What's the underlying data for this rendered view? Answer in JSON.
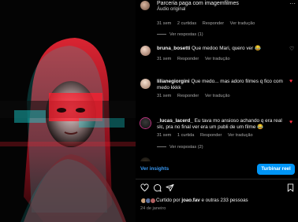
{
  "post": {
    "title": "Parceria paga com imagemfilmes",
    "subtitle": "Áudio original",
    "more_icon": "more-dots-icon"
  },
  "labels": {
    "reply": "Responder",
    "see_translation": "Ver tradução"
  },
  "comments": [
    {
      "meta_time": "31 sem",
      "meta_likes": "2 curtidas",
      "replies": "Ver respostas (1)",
      "text": ""
    },
    {
      "username": "bruna_bosetti",
      "text": "Que medoo Mari, quero ver 😂",
      "meta_time": "31 sem",
      "meta_likes": "",
      "replies": "",
      "liked": false
    },
    {
      "username": "lilianegiorgini",
      "text": "Que medo... mas adoro filmes q fico com medo kkkk",
      "meta_time": "31 sem",
      "meta_likes": "",
      "replies": "",
      "liked": true
    },
    {
      "username": "_lucas_lacerd_",
      "text": "Eu tava mo ansioso achando q era real slc, pra no final ver era um publi de um filme 😂",
      "meta_time": "31 sem",
      "meta_likes": "1 curtida",
      "replies": "Ver respostas (2)",
      "liked": true
    }
  ],
  "footer": {
    "insights": "Ver insights",
    "boost": "Turbinar reel",
    "likes_prefix": "Curtido por",
    "likes_user": "joao.fav",
    "likes_suffix": "e outras 233 pessoas",
    "date": "24 de janeiro"
  },
  "icons": {
    "like": "heart-outline-icon",
    "comment": "comment-icon",
    "share": "share-icon",
    "save": "bookmark-icon"
  },
  "colors": {
    "accent": "#0095f6",
    "link": "#3897f0",
    "heart": "#ff3040",
    "muted": "#a8a8a8"
  }
}
